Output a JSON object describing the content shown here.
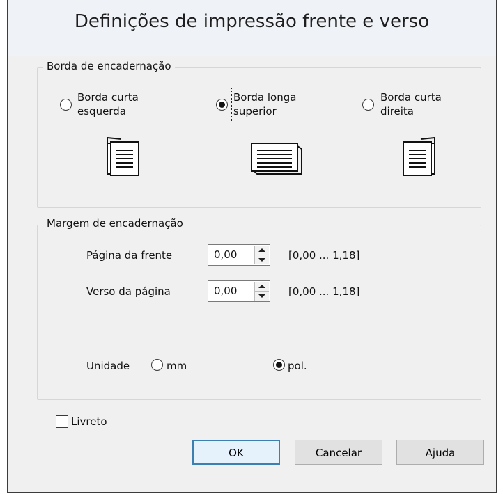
{
  "dialog": {
    "title": "Definições de impressão frente e verso"
  },
  "binding_edge": {
    "legend": "Borda de encadernação",
    "options": [
      {
        "line1": "Borda curta",
        "line2": "esquerda",
        "selected": false,
        "icon": "document-short-left-edge-icon"
      },
      {
        "line1": "Borda longa",
        "line2": "superior",
        "selected": true,
        "icon": "document-long-top-edge-icon"
      },
      {
        "line1": "Borda curta",
        "line2": "direita",
        "selected": false,
        "icon": "document-short-right-edge-icon"
      }
    ]
  },
  "binding_margin": {
    "legend": "Margem de encadernação",
    "front_page": {
      "label": "Página da frente",
      "value": "0,00",
      "range": "[0,00 ... 1,18]"
    },
    "back_page": {
      "label": "Verso da página",
      "value": "0,00",
      "range": "[0,00 ... 1,18]"
    },
    "unit": {
      "label": "Unidade",
      "options": [
        {
          "label": "mm",
          "selected": false
        },
        {
          "label": "pol.",
          "selected": true
        }
      ]
    }
  },
  "booklet": {
    "label": "Livreto",
    "checked": false
  },
  "buttons": {
    "ok": "OK",
    "cancel": "Cancelar",
    "help": "Ajuda"
  },
  "colors": {
    "default_button_border": "#3c7fb1",
    "dialog_bg": "#f0f0f0"
  }
}
